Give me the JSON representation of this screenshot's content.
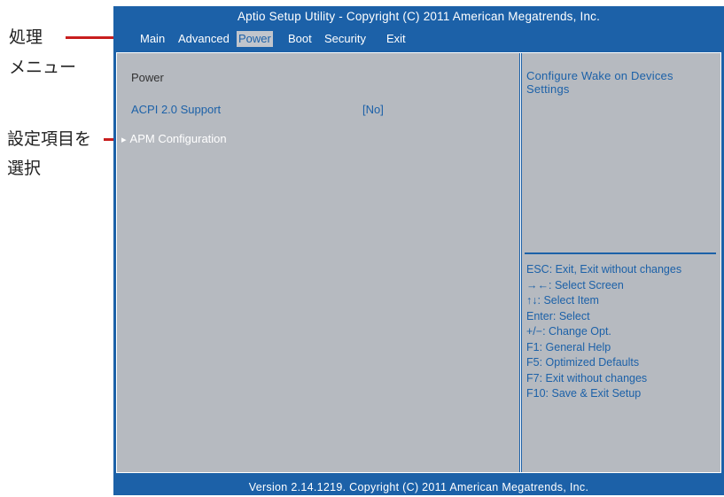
{
  "annotations": {
    "menu_label_line1": "処理",
    "menu_label_line2": "メニュー",
    "select_label_line1": "設定項目を",
    "select_label_line2": "選択"
  },
  "window": {
    "title": "Aptio Setup Utility - Copyright (C) 2011 American Megatrends, Inc."
  },
  "menu": {
    "items": [
      {
        "label": "Main"
      },
      {
        "label": "Advanced"
      },
      {
        "label": "Power",
        "active": true
      },
      {
        "label": "Boot"
      },
      {
        "label": "Security"
      },
      {
        "label": "Exit"
      }
    ]
  },
  "main": {
    "heading": "Power",
    "rows": [
      {
        "label": "ACPI 2.0 Support",
        "value": "[No]"
      },
      {
        "label": "APM Configuration",
        "selected": true
      }
    ]
  },
  "help": {
    "description": "Configure Wake on Devices Settings",
    "keys": [
      "ESC: Exit, Exit without changes",
      "→←: Select Screen",
      "↑↓: Select Item",
      "Enter: Select",
      "+/−: Change Opt.",
      "F1: General Help",
      "F5: Optimized Defaults",
      "F7: Exit without changes",
      "F10: Save & Exit Setup"
    ]
  },
  "footer": {
    "text": "Version 2.14.1219. Copyright (C) 2011 American Megatrends, Inc."
  },
  "colors": {
    "bios_blue": "#1c61a8",
    "panel_gray": "#b6bac0",
    "annotation_red": "#c81e1e"
  }
}
